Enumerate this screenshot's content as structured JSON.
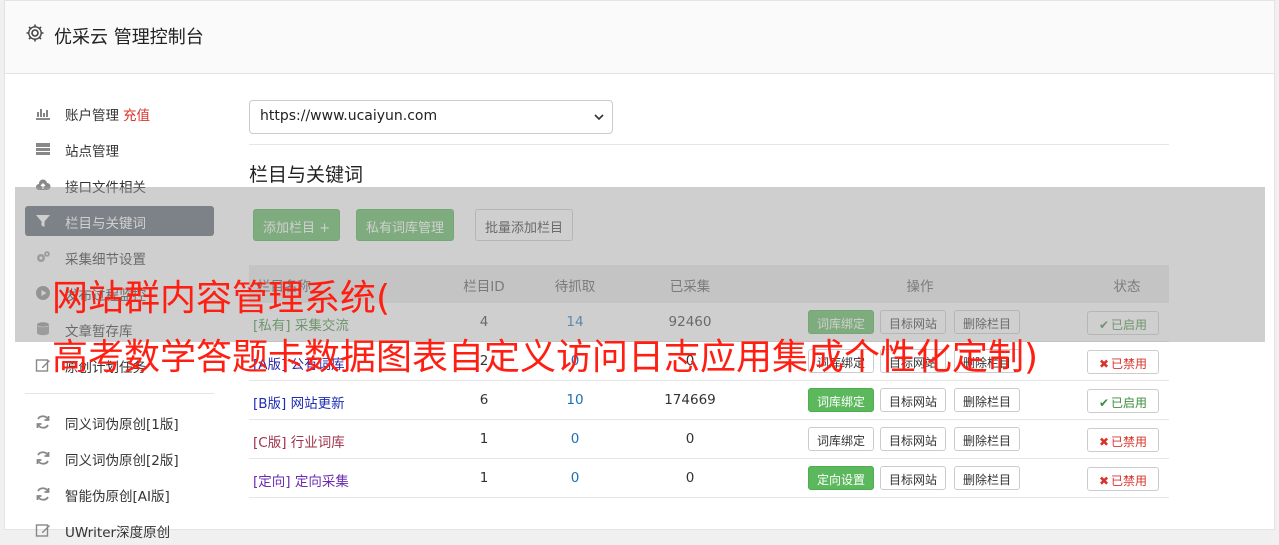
{
  "header": {
    "title": "优采云 管理控制台"
  },
  "sidebar": {
    "items": [
      {
        "label": "账户管理",
        "extra": "充值",
        "icon": "bar-chart-icon"
      },
      {
        "label": "站点管理",
        "icon": "server-icon"
      },
      {
        "label": "接口文件相关",
        "icon": "cloud-upload-icon"
      },
      {
        "label": "栏目与关键词",
        "icon": "filter-icon",
        "active": true
      },
      {
        "label": "采集细节设置",
        "icon": "gears-icon"
      },
      {
        "label": "发布过程监控",
        "icon": "play-circle-icon"
      },
      {
        "label": "文章暂存库",
        "icon": "database-icon"
      },
      {
        "label": "原创计划任务",
        "icon": "edit-icon"
      },
      {
        "label": "同义词伪原创[1版]",
        "icon": "refresh-icon"
      },
      {
        "label": "同义词伪原创[2版]",
        "icon": "refresh-icon"
      },
      {
        "label": "智能伪原创[AI版]",
        "icon": "refresh-icon"
      },
      {
        "label": "UWriter深度原创",
        "icon": "edit-icon"
      }
    ]
  },
  "main": {
    "site_select": "https://www.ucaiyun.com",
    "section_title": "栏目与关键词",
    "buttons": {
      "add_column": "添加栏目 +",
      "private_lib": "私有词库管理",
      "batch_add": "批量添加栏目"
    },
    "table": {
      "headers": {
        "name": "栏目名称",
        "id": "栏目ID",
        "pending": "待抓取",
        "collected": "已采集",
        "actions": "操作",
        "status": "状态"
      },
      "rows": [
        {
          "tag": "[私有]",
          "name": "采集交流",
          "id": "4",
          "pending": "14",
          "collected": "92460",
          "action1": "词库绑定",
          "action1_style": "green",
          "action2": "目标网站",
          "action3": "删除栏目",
          "status": "已启用",
          "status_on": true,
          "color": "#3c8d3c"
        },
        {
          "tag": "[A版]",
          "name": "公有词库",
          "id": "2",
          "pending": "0",
          "collected": "0",
          "action1": "词库绑定",
          "action1_style": "default",
          "action2": "目标网站",
          "action3": "删除栏目",
          "status": "已禁用",
          "status_on": false,
          "color": "#2a2aa8"
        },
        {
          "tag": "[B版]",
          "name": "网站更新",
          "id": "6",
          "pending": "10",
          "collected": "174669",
          "action1": "词库绑定",
          "action1_style": "green",
          "action2": "目标网站",
          "action3": "删除栏目",
          "status": "已启用",
          "status_on": true,
          "color": "#1f2fb5"
        },
        {
          "tag": "[C版]",
          "name": "行业词库",
          "id": "1",
          "pending": "0",
          "collected": "0",
          "action1": "词库绑定",
          "action1_style": "default",
          "action2": "目标网站",
          "action3": "删除栏目",
          "status": "已禁用",
          "status_on": false,
          "color": "#a0324a"
        },
        {
          "tag": "[定向]",
          "name": "定向采集",
          "id": "1",
          "pending": "0",
          "collected": "0",
          "action1": "定向设置",
          "action1_style": "green",
          "action2": "目标网站",
          "action3": "删除栏目",
          "status": "已禁用",
          "status_on": false,
          "color": "#6a2db0"
        }
      ]
    }
  },
  "watermark": {
    "line1": "网站群内容管理系统(",
    "line2": "高考数学答题卡数据图表自定义访问日志应用集成个性化定制)"
  },
  "colors": {
    "green": "#5cb85c",
    "active_bg": "#5a6470",
    "watermark": "#ff1e12",
    "recharge": "#d9342b",
    "link_blue": "#1f6fb5"
  }
}
